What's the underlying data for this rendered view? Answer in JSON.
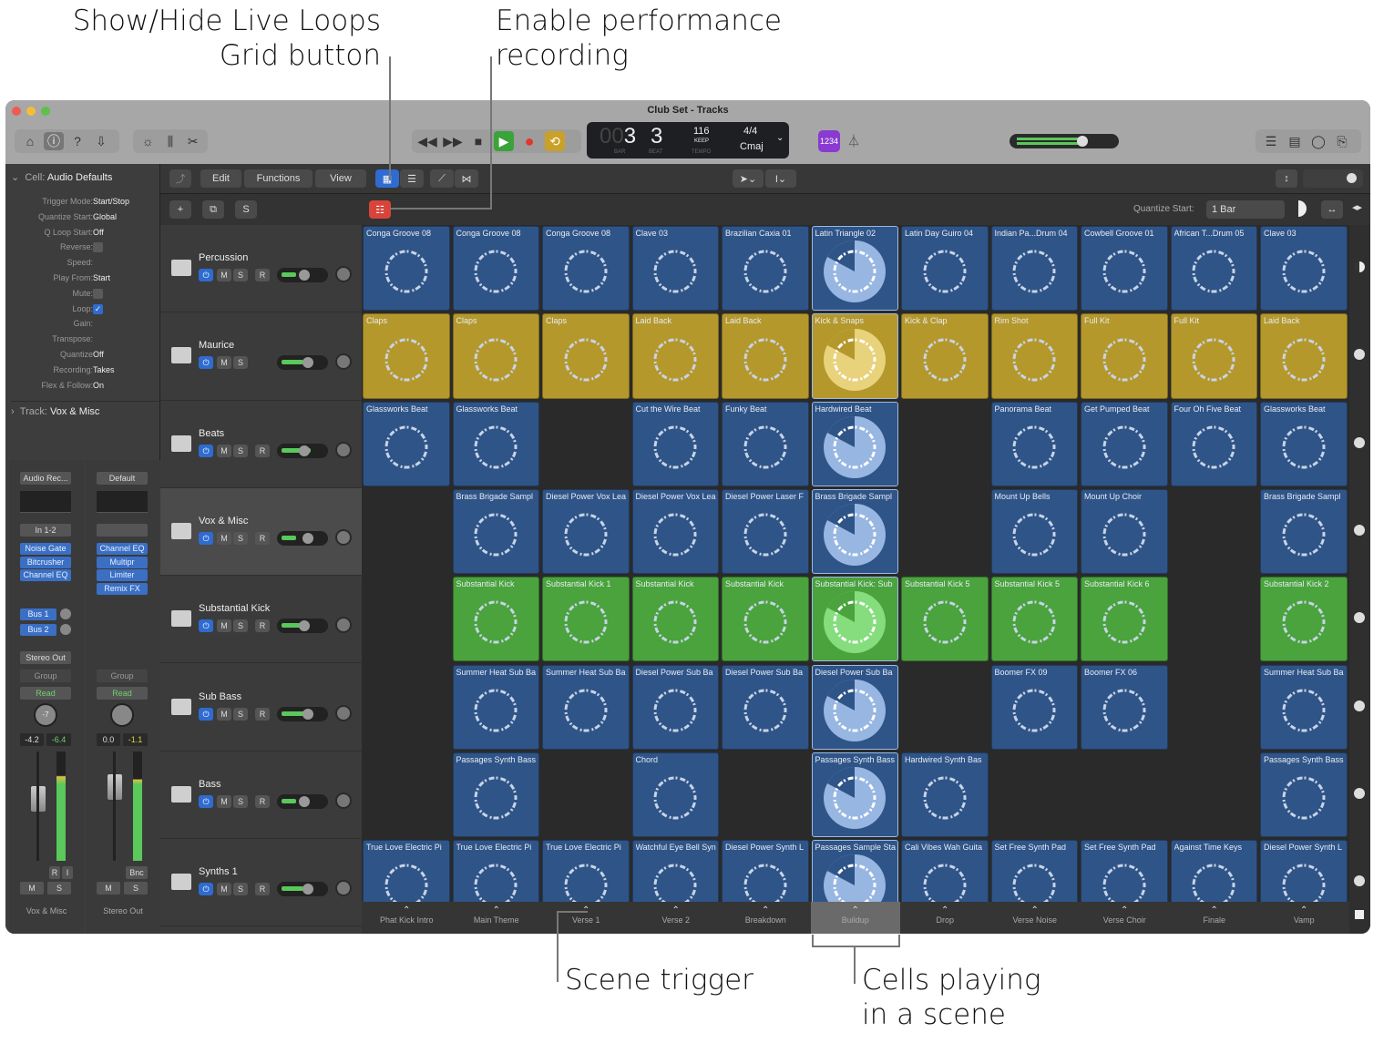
{
  "annotations": {
    "grid_button": [
      "Show/Hide Live Loops",
      "Grid button"
    ],
    "perf_rec": [
      "Enable performance",
      "recording"
    ],
    "scene_trigger": "Scene trigger",
    "cells_playing": [
      "Cells playing",
      "in a scene"
    ]
  },
  "window": {
    "title": "Club Set - Tracks"
  },
  "transport": {
    "bar": "3",
    "beat": "3",
    "bar_label": "BAR",
    "beat_label": "BEAT",
    "tempo": "116",
    "tempo_mode": "KEEP",
    "tempo_label": "TEMPO",
    "signature": "4/4",
    "key": "Cmaj",
    "count_in": "1234"
  },
  "toolbar2": {
    "edit": "Edit",
    "functions": "Functions",
    "view": "View"
  },
  "toolbar3": {
    "quantize_label": "Quantize Start:",
    "quantize_value": "1 Bar"
  },
  "inspector": {
    "cell_header_k": "Cell:",
    "cell_header_v": "Audio Defaults",
    "rows": [
      {
        "k": "Trigger Mode:",
        "v": "Start/Stop"
      },
      {
        "k": "Quantize Start:",
        "v": "Global"
      },
      {
        "k": "Q Loop Start:",
        "v": "Off"
      },
      {
        "k": "Reverse:",
        "v": ""
      },
      {
        "k": "Speed:",
        "v": ""
      },
      {
        "k": "Play From:",
        "v": "Start"
      },
      {
        "k": "Mute:",
        "v": ""
      },
      {
        "k": "Loop:",
        "v": "✓"
      },
      {
        "k": "Gain:",
        "v": ""
      },
      {
        "k": "Transpose:",
        "v": ""
      },
      {
        "k": "Quantize",
        "v": "Off"
      },
      {
        "k": "Recording:",
        "v": "Takes"
      },
      {
        "k": "Flex & Follow:",
        "v": "On"
      }
    ],
    "track_header_k": "Track:",
    "track_header_v": "Vox & Misc"
  },
  "strips": [
    {
      "setting": "Audio Rec...",
      "input": "In 1-2",
      "plugins": [
        "Noise Gate",
        "Bitcrusher",
        "Channel EQ"
      ],
      "sends": [
        "Bus 1",
        "Bus 2"
      ],
      "output": "Stereo Out",
      "group": "Group",
      "automation": "Read",
      "pan": "-7",
      "vol": "-4.2",
      "peak": "-6.4",
      "rec": "R",
      "inp": "I",
      "mute": "M",
      "solo": "S",
      "name": "Vox & Misc"
    },
    {
      "setting": "Default",
      "input": "",
      "plugins": [
        "Channel EQ",
        "Multipr",
        "Limiter",
        "Remix FX"
      ],
      "sends": [],
      "output": "",
      "group": "Group",
      "automation": "Read",
      "pan": "",
      "vol": "0.0",
      "peak": "-1.1",
      "rec": "Bnc",
      "inp": "",
      "mute": "M",
      "solo": "S",
      "name": "Stereo Out"
    }
  ],
  "tracks": [
    {
      "name": "Percussion",
      "rec": true,
      "color": "#2f5487"
    },
    {
      "name": "Maurice",
      "rec": false,
      "color": "#b5982b"
    },
    {
      "name": "Beats",
      "rec": true,
      "color": "#2f5487"
    },
    {
      "name": "Vox & Misc",
      "rec": true,
      "color": "#2f5487",
      "selected": true
    },
    {
      "name": "Substantial Kick",
      "rec": true,
      "color": "#4aa33c"
    },
    {
      "name": "Sub Bass",
      "rec": true,
      "color": "#2f5487"
    },
    {
      "name": "Bass",
      "rec": true,
      "color": "#2f5487"
    },
    {
      "name": "Synths 1",
      "rec": true,
      "color": "#2f5487"
    }
  ],
  "track_buttons": {
    "mute": "M",
    "solo": "S",
    "rec": "R"
  },
  "cells": [
    [
      "Conga Groove 08",
      "Conga Groove 08",
      "Conga Groove 08",
      "Clave 03",
      "Brazilian Caxia 01",
      "Latin Triangle 02",
      "Latin Day Guiro 04",
      "Indian Pa...Drum 04",
      "Cowbell Groove 01",
      "African T...Drum 05",
      "Clave 03"
    ],
    [
      "Claps",
      "Claps",
      "Claps",
      "Laid Back",
      "Laid Back",
      "Kick & Snaps",
      "Kick & Clap",
      "Rim Shot",
      "Full Kit",
      "Full Kit",
      "Laid Back"
    ],
    [
      "Glassworks Beat",
      "Glassworks Beat",
      null,
      "Cut the Wire Beat",
      "Funky Beat",
      "Hardwired Beat",
      null,
      "Panorama Beat",
      "Get Pumped Beat",
      "Four Oh Five Beat",
      "Glassworks Beat"
    ],
    [
      null,
      "Brass Brigade Sampl",
      "Diesel Power Vox Lea",
      "Diesel Power Vox Lea",
      "Diesel Power Laser F",
      "Brass Brigade Sampl",
      null,
      "Mount Up Bells",
      "Mount Up Choir",
      null,
      "Brass Brigade Sampl"
    ],
    [
      null,
      "Substantial Kick",
      "Substantial Kick 1",
      "Substantial Kick",
      "Substantial Kick",
      "Substantial Kick: Sub",
      "Substantial Kick 5",
      "Substantial Kick 5",
      "Substantial Kick 6",
      null,
      "Substantial Kick 2"
    ],
    [
      null,
      "Summer Heat Sub Ba",
      "Summer Heat Sub Ba",
      "Diesel Power Sub Ba",
      "Diesel Power Sub Ba",
      "Diesel Power Sub Ba",
      null,
      "Boomer FX 09",
      "Boomer FX 06",
      null,
      "Summer Heat Sub Ba"
    ],
    [
      null,
      "Passages Synth Bass",
      null,
      "Chord",
      null,
      "Passages Synth Bass",
      "Hardwired Synth Bas",
      null,
      null,
      null,
      "Passages Synth Bass"
    ],
    [
      "True Love Electric Pi",
      "True Love Electric Pi",
      "True Love Electric Pi",
      "Watchful Eye Bell Syn",
      "Diesel Power Synth L",
      "Passages Sample Sta",
      "Cali Vibes Wah Guita",
      "Set Free Synth Pad",
      "Set Free Synth Pad",
      "Against Time Keys",
      "Diesel Power Synth L"
    ]
  ],
  "playing_scene": 5,
  "scenes": [
    "Phat Kick Intro",
    "Main Theme",
    "Verse 1",
    "Verse 2",
    "Breakdown",
    "Buildup",
    "Drop",
    "Verse Noise",
    "Verse Choir",
    "Finale",
    "Vamp"
  ],
  "colors": {
    "playing_fill": "#a9c8f2",
    "accent": "#2f6bd0",
    "record": "#e0362b",
    "play": "#3aa33a",
    "cycle": "#c9a028",
    "perf_rec": "#d9443a"
  }
}
